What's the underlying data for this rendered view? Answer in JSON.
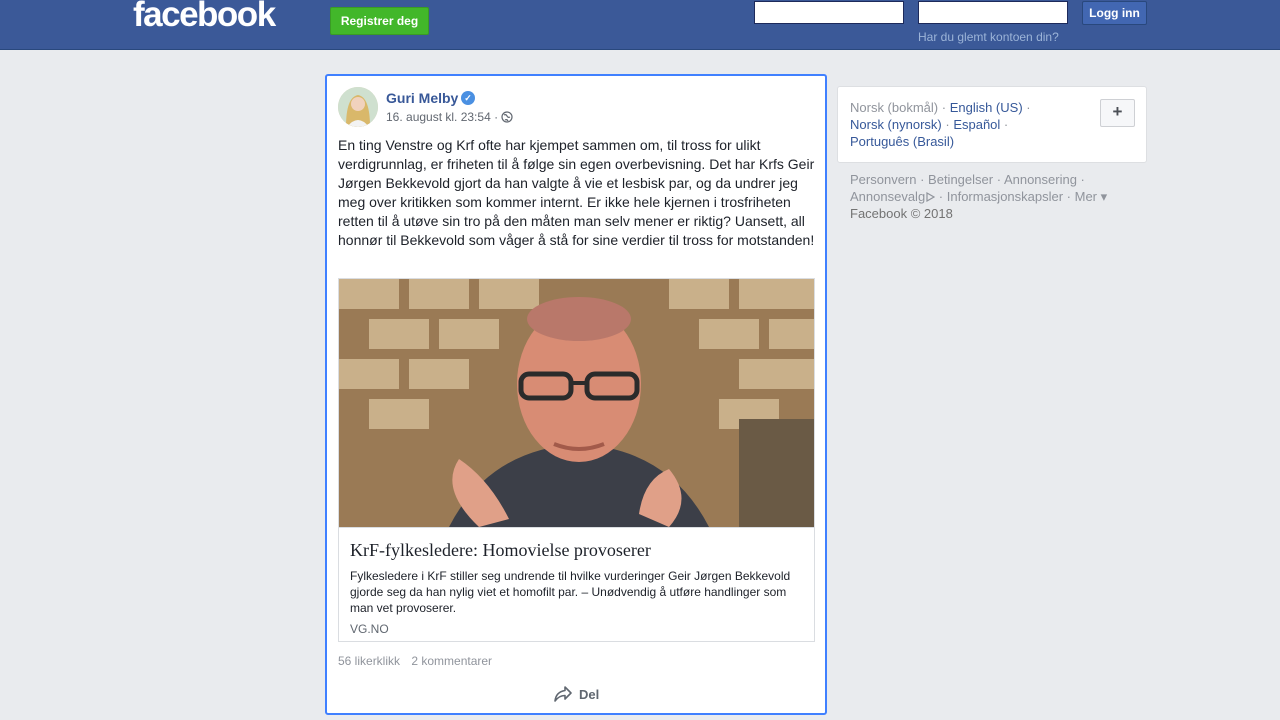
{
  "header": {
    "logo": "facebook",
    "register_label": "Registrer deg",
    "email_value": "",
    "password_value": "",
    "login_label": "Logg inn",
    "forgot_label": "Har du glemt kontoen din?"
  },
  "post": {
    "author": "Guri Melby",
    "timestamp": "16. august kl. 23:54 ·",
    "text": "En ting Venstre og Krf ofte har kjempet sammen om, til tross for ulikt verdigrunnlag, er friheten til å følge sin egen overbevisning. Det har Krfs Geir Jørgen Bekkevold gjort da han valgte å vie et lesbisk par, og da undrer jeg meg over kritikken som kommer internt. Er ikke hele kjernen i trosfriheten retten til å utøve sin tro på den måten man selv mener er riktig? Uansett, all honnør til Bekkevold som våger å stå for sine verdier til tross for motstanden!",
    "link": {
      "title": "KrF-fylkesledere: Homovielse provoserer",
      "description": "Fylkesledere i KrF stiller seg undrende til hvilke vurderinger Geir Jørgen Bekkevold gjorde seg da han nylig viet et homofilt par. – Unødvendig å utføre handlinger som man vet provoserer.",
      "domain": "VG.NO"
    },
    "likes": "56 likerklikk",
    "comments": "2 kommentarer",
    "share_label": "Del"
  },
  "languages": {
    "current": "Norsk (bokmål)",
    "options": [
      "English (US)",
      "Norsk (nynorsk)",
      "Español",
      "Português (Brasil)"
    ],
    "separator": "·",
    "more_label": "+"
  },
  "footer": {
    "links": [
      "Personvern",
      "Betingelser",
      "Annonsering",
      "Annonsevalg",
      "Informasjonskapsler",
      "Mer"
    ],
    "copyright": "Facebook © 2018"
  },
  "colors": {
    "brand": "#3b5998",
    "register_green": "#42b72a",
    "link_blue": "#385898",
    "focus_border": "#4080ff"
  }
}
